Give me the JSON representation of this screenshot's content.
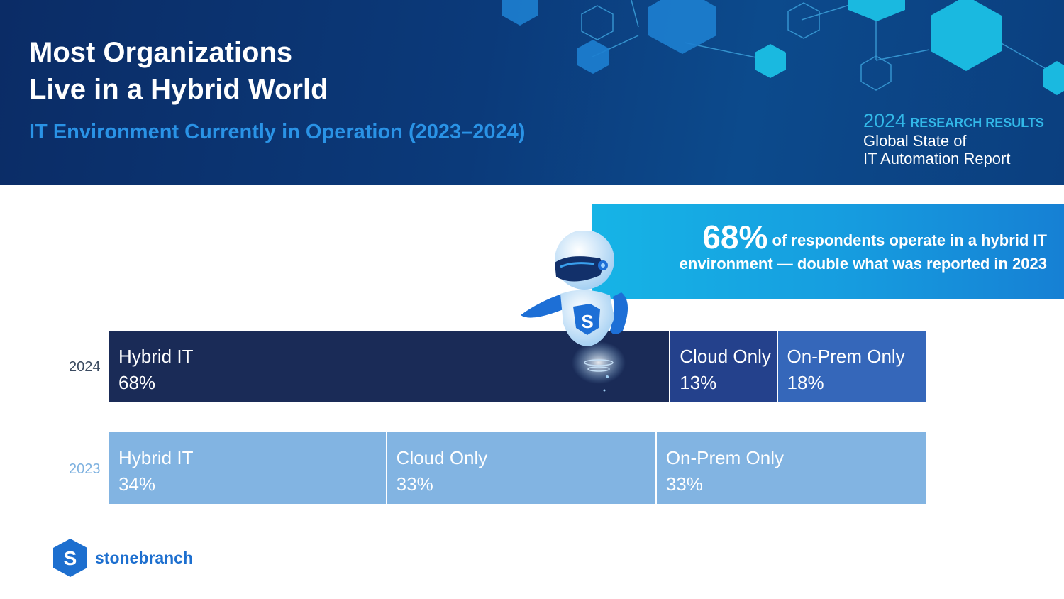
{
  "header": {
    "title_line1": "Most Organizations",
    "title_line2": "Live in a Hybrid World",
    "subtitle": "IT Environment Currently in Operation (2023–2024)",
    "research_year": "2024",
    "research_results": "RESEARCH RESULTS",
    "report_line1": "Global State of",
    "report_line2": "IT Automation Report"
  },
  "callout": {
    "big_value": "68%",
    "line1_rest": "of respondents operate in a hybrid IT",
    "line2": "environment — double what was reported in 2023"
  },
  "chart_data": {
    "type": "bar",
    "orientation": "horizontal",
    "stacked": true,
    "rows": [
      {
        "year": "2024",
        "segments": [
          {
            "label": "Hybrid IT",
            "value": 68,
            "display": "68%",
            "color": "#1a2b57"
          },
          {
            "label": "Cloud Only",
            "value": 13,
            "display": "13%",
            "color": "#24418c"
          },
          {
            "label": "On-Prem Only",
            "value": 18,
            "display": "18%",
            "color": "#3567ba"
          }
        ]
      },
      {
        "year": "2023",
        "segments": [
          {
            "label": "Hybrid IT",
            "value": 34,
            "display": "34%",
            "color": "#82b4e2"
          },
          {
            "label": "Cloud Only",
            "value": 33,
            "display": "33%",
            "color": "#82b4e2"
          },
          {
            "label": "On-Prem Only",
            "value": 33,
            "display": "33%",
            "color": "#82b4e2"
          }
        ]
      }
    ]
  },
  "logo": {
    "mark": "S",
    "name": "stonebranch"
  },
  "colors": {
    "header_bg": "#0b2c66",
    "accent_blue": "#2a93e6",
    "callout_bg": "#16a6e2"
  },
  "icons": [
    "hexagon-network-decoration",
    "robot-mascot-icon",
    "stonebranch-logo-icon"
  ]
}
